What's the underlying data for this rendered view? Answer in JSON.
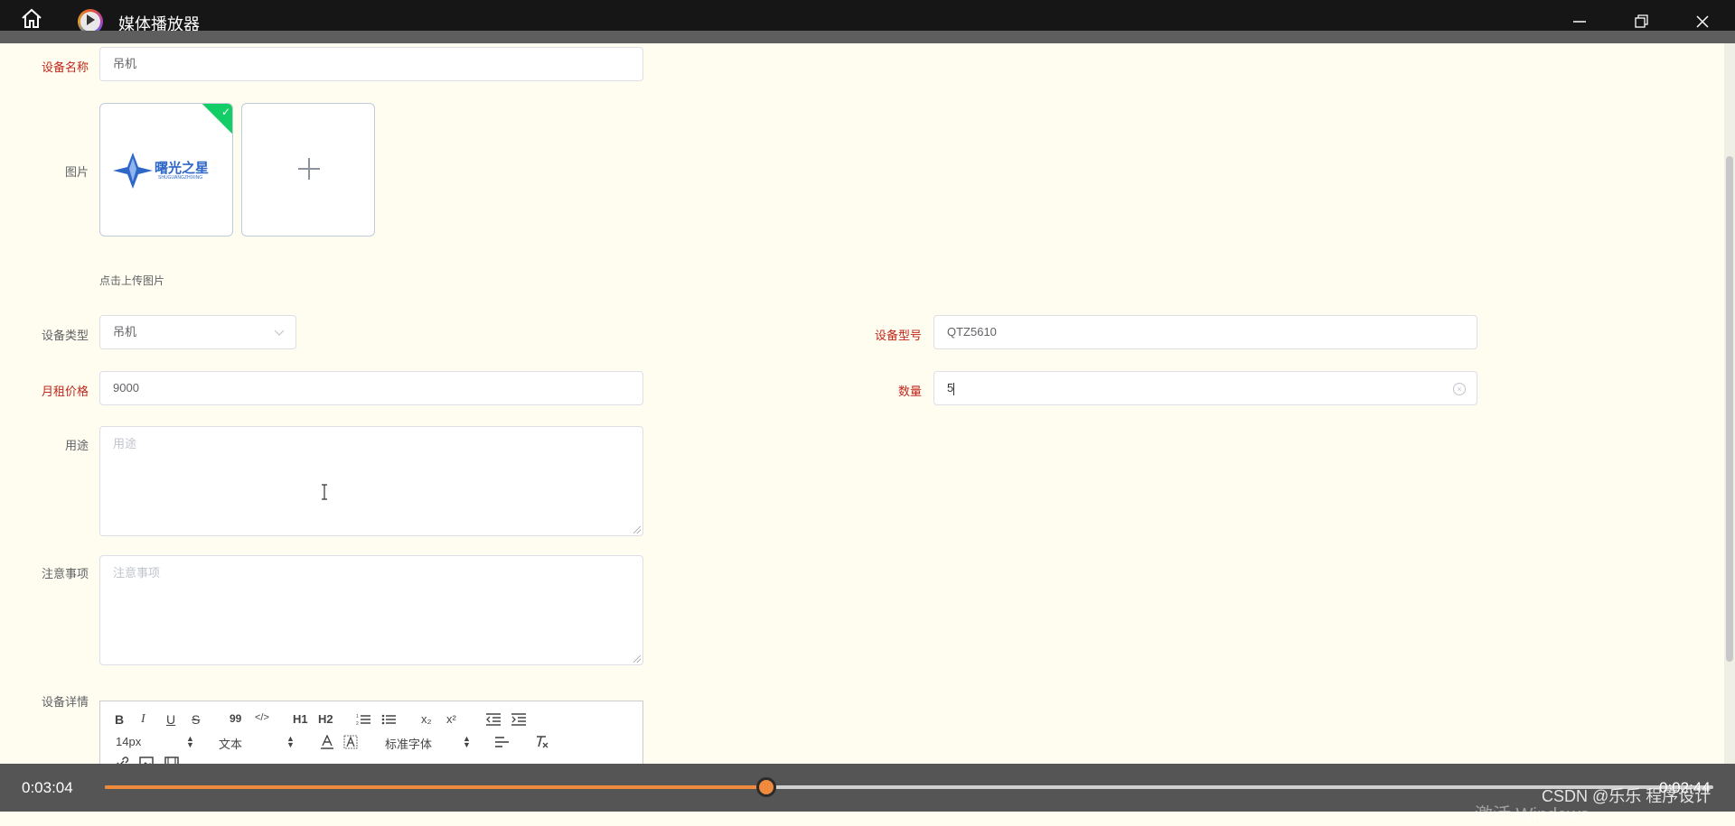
{
  "window": {
    "title": "媒体播放器"
  },
  "form": {
    "device_name": {
      "label": "设备名称",
      "value": "吊机"
    },
    "image": {
      "label": "图片",
      "hint": "点击上传图片",
      "logo_text": "曙光之星",
      "logo_subtext": "SHUGUANGZHIXING"
    },
    "device_type": {
      "label": "设备类型",
      "value": "吊机"
    },
    "device_model": {
      "label": "设备型号",
      "value": "QTZ5610"
    },
    "monthly_price": {
      "label": "月租价格",
      "value": "9000"
    },
    "quantity": {
      "label": "数量",
      "value": "5"
    },
    "usage": {
      "label": "用途",
      "placeholder": "用途"
    },
    "notes": {
      "label": "注意事项",
      "placeholder": "注意事项"
    },
    "details": {
      "label": "设备详情"
    }
  },
  "editor": {
    "bold": "B",
    "italic": "I",
    "underline": "U",
    "strike": "S",
    "quote": "99",
    "code": "</>",
    "h1": "H1",
    "h2": "H2",
    "sub": "x₂",
    "sup": "x²",
    "font_size": "14px",
    "header_select": "文本",
    "font_family": "标准字体"
  },
  "player": {
    "elapsed": "0:03:04",
    "remaining": "0:02:44",
    "progress": 0.411,
    "accent": "#f08a3c"
  },
  "overlay": {
    "watermark": "CSDN @乐乐 程序设计",
    "activate_windows": "激活 Windows"
  }
}
